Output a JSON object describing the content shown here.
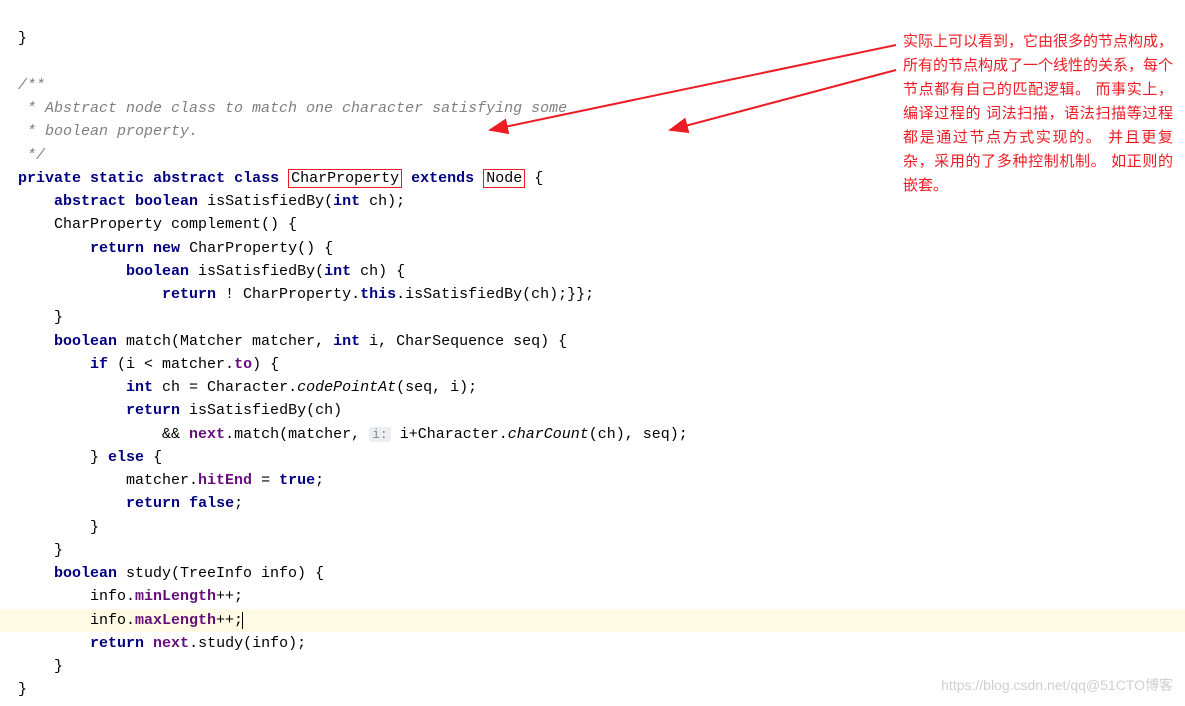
{
  "code": {
    "brace_close_top": "}",
    "comment_open": "/**",
    "comment_l1": " * Abstract node class to match one character satisfying some",
    "comment_l2": " * boolean property.",
    "comment_close": " */",
    "kw_private": "private",
    "kw_static": "static",
    "kw_abstract": "abstract",
    "kw_class": "class",
    "cls_charprop": "CharProperty",
    "kw_extends": "extends",
    "cls_node": "Node",
    "brace_open": " {",
    "kw_abstract2": "abstract",
    "kw_boolean": "boolean",
    "m_isSatisfiedBy": " isSatisfiedBy(",
    "kw_int": "int",
    "p_ch_close": " ch);",
    "compl_sig": "CharProperty complement() {",
    "kw_return": "return",
    "kw_new": "new",
    "new_cp": " CharProperty() {",
    "inner_sig_a": " isSatisfiedBy(",
    "inner_sig_b": " ch) {",
    "inner_ret_a": " ! CharProperty.",
    "kw_this": "this",
    "inner_ret_b": ".isSatisfiedBy(ch);}};",
    "brace_close": "}",
    "match_sig_a": " match(Matcher matcher, ",
    "match_sig_b": " i, CharSequence seq) {",
    "kw_if": "if",
    "if_a": " (i < matcher.",
    "fld_to": "to",
    "if_b": ") {",
    "ch_assign_a": " ch = Character.",
    "m_codePointAt": "codePointAt",
    "ch_assign_b": "(seq, i);",
    "ret_sat": " isSatisfiedBy(ch)",
    "and_a": "&& ",
    "fld_next": "next",
    "and_b": ".match(matcher, ",
    "hint_i": "i:",
    "and_c": " i+Character.",
    "m_charCount": "charCount",
    "and_d": "(ch), seq);",
    "kw_else": "else",
    "else_open": " {",
    "hitend_a": "matcher.",
    "fld_hitEnd": "hitEnd",
    "hitend_b": " = ",
    "kw_true": "true",
    "semi": ";",
    "kw_false": "false",
    "study_sig": " study(TreeInfo info) {",
    "info_a": "info.",
    "fld_minLength": "minLength",
    "pp": "++;",
    "fld_maxLength": "maxLength",
    "study_ret": ".study(info);"
  },
  "annotation": "实际上可以看到，它由很多的节点构成，所有的节点构成了一个线性的关系，每个节点都有自己的匹配逻辑。 而事实上，编译过程的 词法扫描，语法扫描等过程都是通过节点方式实现的。 并且更复杂，采用的了多种控制机制。  如正则的嵌套。",
  "watermark": "https://blog.csdn.net/qq@51CTO博客"
}
